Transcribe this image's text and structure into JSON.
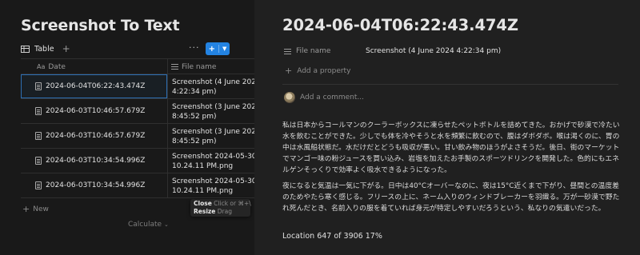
{
  "database": {
    "title": "Screenshot To Text",
    "view_label": "Table",
    "columns": {
      "date": "Date",
      "file_name": "File name"
    },
    "rows": [
      {
        "date": "2024-06-04T06:22:43.474Z",
        "file_name": "Screenshot (4 June 2024\n4:22:34 pm)"
      },
      {
        "date": "2024-06-03T10:46:57.679Z",
        "file_name": "Screenshot (3 June 2024\n8:45:52 pm)"
      },
      {
        "date": "2024-06-03T10:46:57.679Z",
        "file_name": "Screenshot (3 June 2024\n8:45:52 pm)"
      },
      {
        "date": "2024-06-03T10:34:54.996Z",
        "file_name": "Screenshot 2024-05-30 at\n10.24.11 PM.png"
      },
      {
        "date": "2024-06-03T10:34:54.996Z",
        "file_name": "Screenshot 2024-05-30 at\n10.24.11 PM.png"
      }
    ],
    "new_label": "New",
    "calculate_label": "Calculate"
  },
  "tooltip": {
    "close_label": "Close",
    "close_hint": "Click or ⌘+\\",
    "resize_label": "Resize",
    "resize_hint": "Drag"
  },
  "page": {
    "title": "2024-06-04T06:22:43.474Z",
    "property_name": "File name",
    "property_value": "Screenshot (4 June 2024 4:22:34 pm)",
    "add_property": "Add a property",
    "add_comment": "Add a comment...",
    "paragraph1": "私は日本からコールマンのクーラーボックスに凍らせたペットボトルを詰めてきた。おかげで砂漠で冷たい水を飲むことができた。少しでも体を冷やそうと水を頻繁に飲むので、腹はダボダボ。喉は渇くのに、胃の中は水風船状態だ。水だけだとどうも吸収が悪い。甘い飲み物のほうがよさそうだ。後日、街のマーケットでマンゴー味の粉ジュースを買い込み、岩塩を加えたお手製のスポーツドリンクを開発した。色的にもエネルゲンそっくりで効率よく吸水できるようになった。",
    "paragraph2": "夜になると気温は一気に下がる。日中は40°Cオーバーなのに、夜は15°C近くまで下がり、昼間との温度差のためやたら寒く感じる。フリースの上に、ネーム入りのウィンドブレーカーを羽織る。万が一砂漠で野たれ死んだとき、名前入りの服を着ていれば身元が特定しやすいだろうという、私なりの気遣いだった。",
    "location": "Location 647 of 3906  17%"
  },
  "icons": {
    "table": "table-icon",
    "add": "plus-icon",
    "more": "more-icon",
    "new_dropdown": "chevron-down-icon",
    "page": "document-icon",
    "text_property": "text-property-icon",
    "avatar": "avatar"
  },
  "colors": {
    "accent": "#2383e2",
    "pane_left": "#191919",
    "pane_right": "#202020"
  }
}
